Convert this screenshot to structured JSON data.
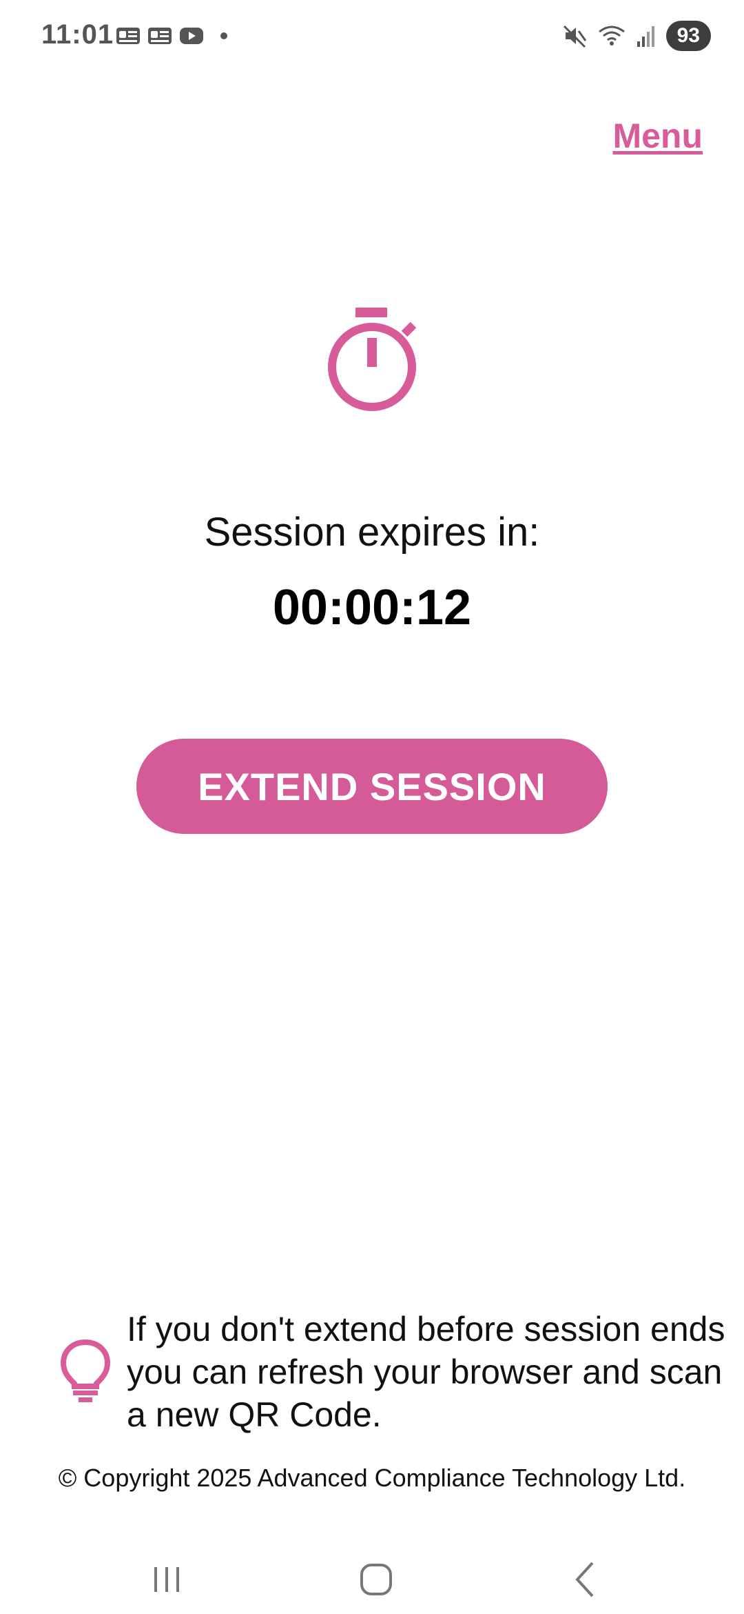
{
  "status_bar": {
    "time": "11:01",
    "battery": "93",
    "icons": [
      "notification-app-icon",
      "notification-app-icon",
      "youtube-icon",
      "notification-dot",
      "mute-icon",
      "wifi-icon",
      "signal-icon",
      "battery-icon"
    ]
  },
  "header": {
    "menu_label": "Menu"
  },
  "session": {
    "icon": "stopwatch-icon",
    "label": "Session expires in:",
    "countdown": "00:00:12",
    "extend_button_label": "EXTEND SESSION"
  },
  "tip": {
    "icon": "lightbulb-icon",
    "text": "If you don't extend before session ends you can refresh your browser and scan a new QR Code."
  },
  "footer": {
    "copyright": "© Copyright 2025 Advanced Compliance Technology Ltd."
  },
  "navigation": {
    "buttons": [
      "recent-apps-icon",
      "home-icon",
      "back-icon"
    ]
  },
  "colors": {
    "accent": "#d45b97",
    "link": "#d85c9a",
    "text": "#111111",
    "status_icons": "#555555"
  }
}
